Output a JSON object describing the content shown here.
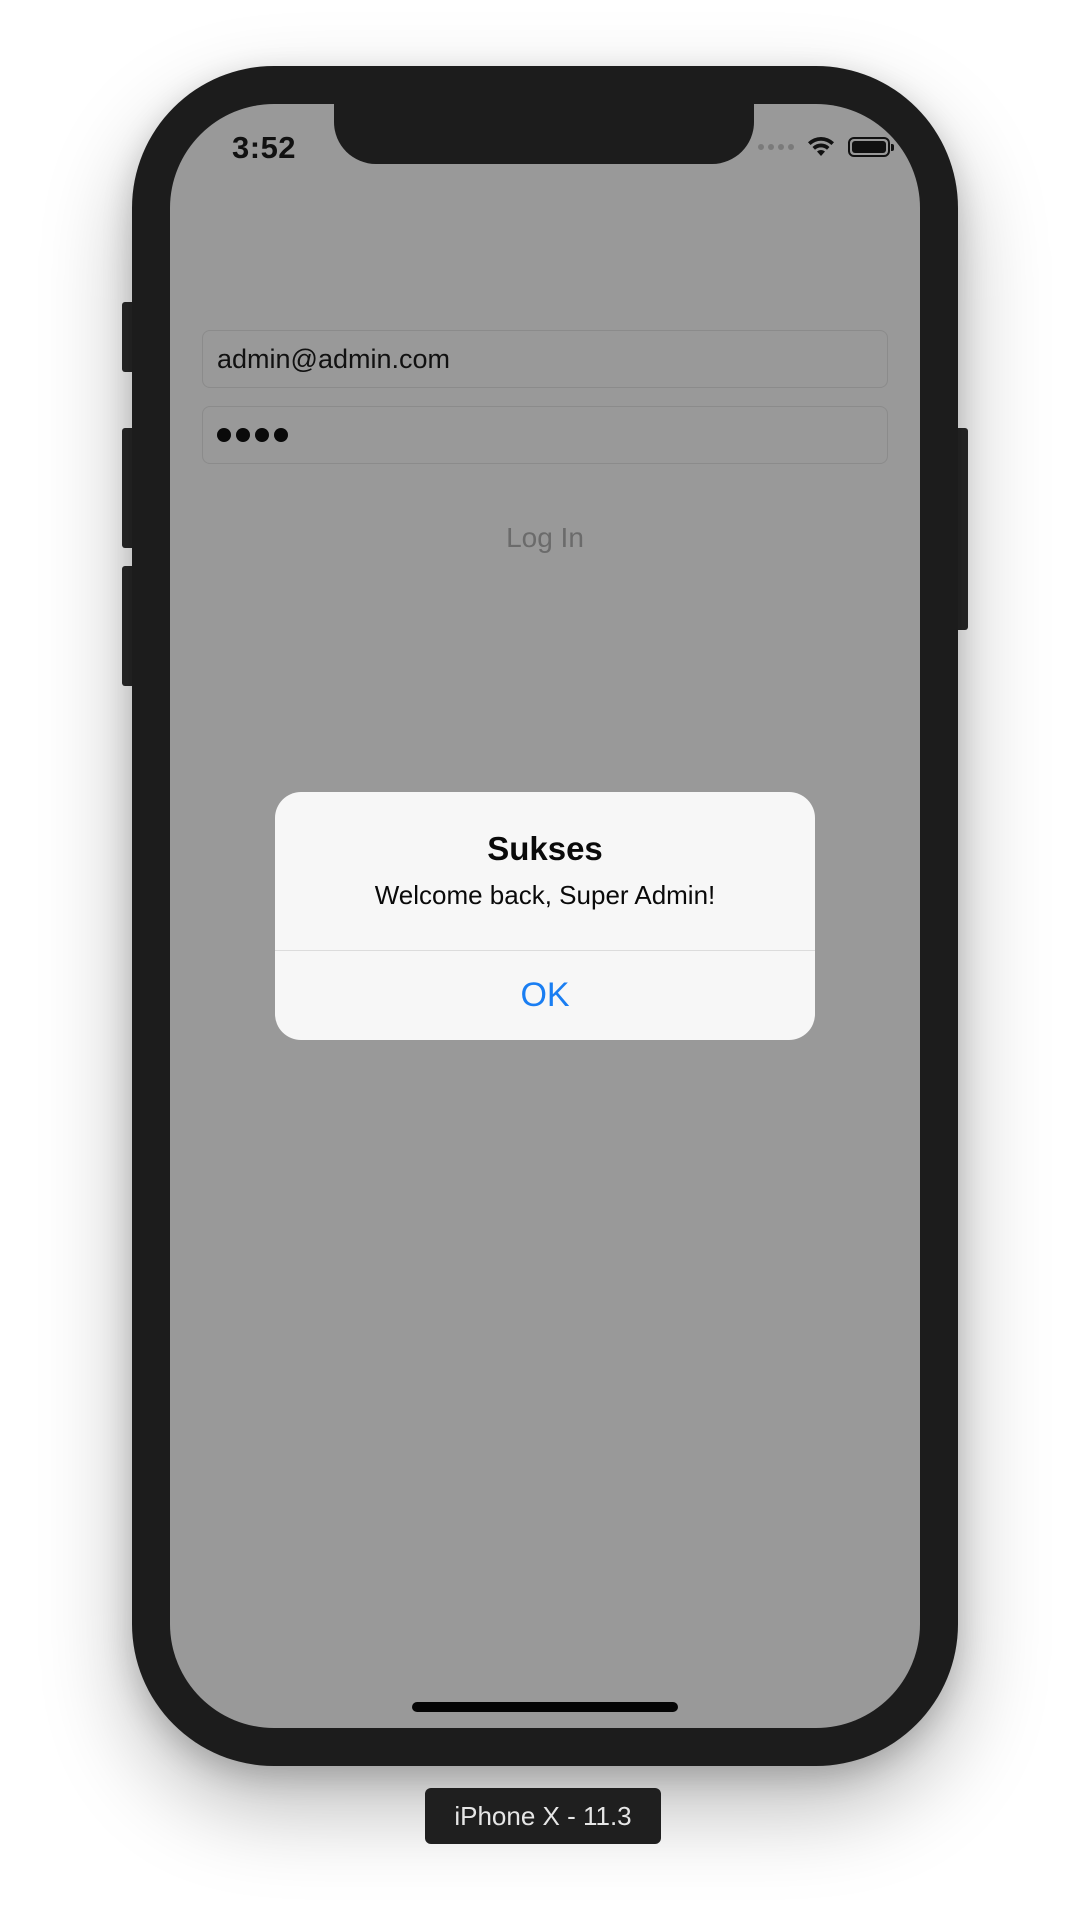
{
  "status_bar": {
    "time": "3:52",
    "icons": [
      "cellular-signal-icon",
      "wifi-icon",
      "battery-icon"
    ]
  },
  "login_form": {
    "email_value": "admin@admin.com",
    "password_mask_length": 4,
    "login_button_label": "Log In"
  },
  "alert": {
    "title": "Sukses",
    "message": "Welcome back, Super Admin!",
    "ok_label": "OK"
  },
  "device": {
    "label": "iPhone X - 11.3"
  },
  "colors": {
    "screen_dim_bg": "#999999",
    "alert_bg": "#f7f7f7",
    "alert_button_accent": "#1a7ef2",
    "bezel": "#1c1c1c"
  }
}
